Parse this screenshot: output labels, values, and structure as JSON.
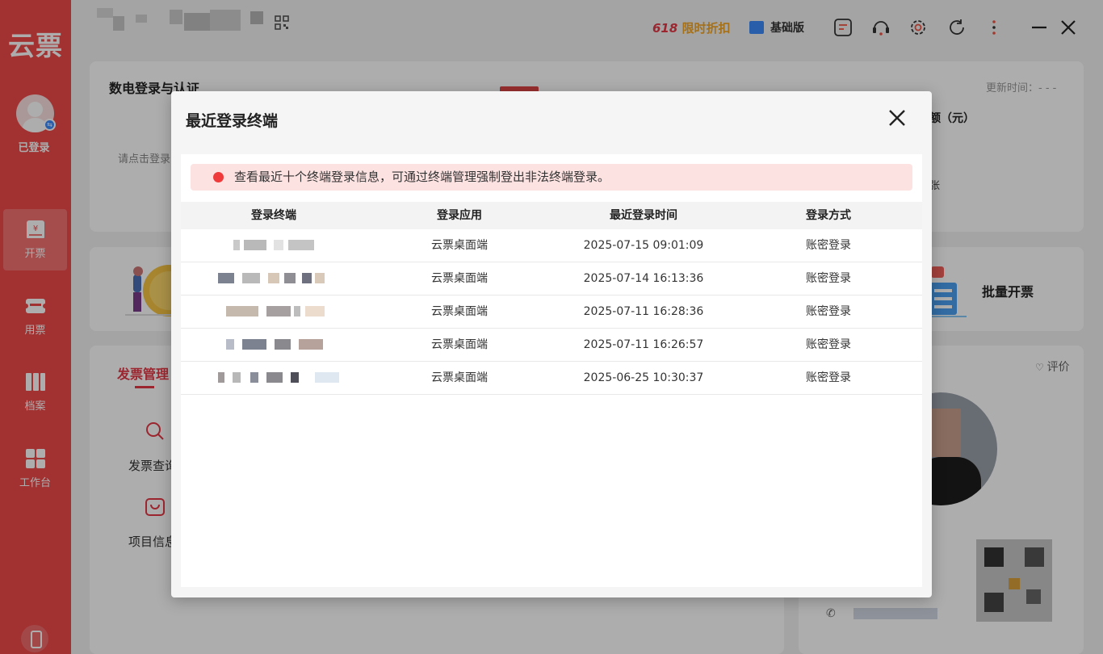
{
  "sidebar": {
    "logo": "云票",
    "login_status": "已登录",
    "items": [
      {
        "label": "开票",
        "icon": "invoice-icon"
      },
      {
        "label": "用票",
        "icon": "ticket-icon"
      },
      {
        "label": "档案",
        "icon": "archive-icon"
      },
      {
        "label": "工作台",
        "icon": "workbench-icon"
      }
    ],
    "bottom_icon": "mobile-phone-icon"
  },
  "topbar": {
    "promo_num": "618",
    "promo_text": "限时折扣",
    "edition": "基础版",
    "icons": [
      "message-icon",
      "support-icon",
      "settings-icon",
      "refresh-icon",
      "more-icon",
      "minimize-icon",
      "close-icon"
    ]
  },
  "background": {
    "card1_title": "数电登录与认证",
    "card1_hint": "请点击登录",
    "update_time": "更新时间：- - -",
    "amount_label": "额（元）",
    "amount_suffix": "张",
    "batch_invoice": "批量开票",
    "tab_invoice_mgmt": "发票管理",
    "invoice_query": "发票查询",
    "project_info": "项目信息",
    "rate_label": "评价"
  },
  "modal": {
    "title": "最近登录终端",
    "notice": "查看最近十个终端登录信息，可通过终端管理强制登出非法终端登录。",
    "columns": [
      "登录终端",
      "登录应用",
      "最近登录时间",
      "登录方式"
    ],
    "rows": [
      {
        "app": "云票桌面端",
        "time": "2025-07-15 09:01:09",
        "mode": "账密登录"
      },
      {
        "app": "云票桌面端",
        "time": "2025-07-14 16:13:36",
        "mode": "账密登录"
      },
      {
        "app": "云票桌面端",
        "time": "2025-07-11 16:28:36",
        "mode": "账密登录"
      },
      {
        "app": "云票桌面端",
        "time": "2025-07-11 16:26:57",
        "mode": "账密登录"
      },
      {
        "app": "云票桌面端",
        "time": "2025-06-25 10:30:37",
        "mode": "账密登录"
      }
    ]
  }
}
